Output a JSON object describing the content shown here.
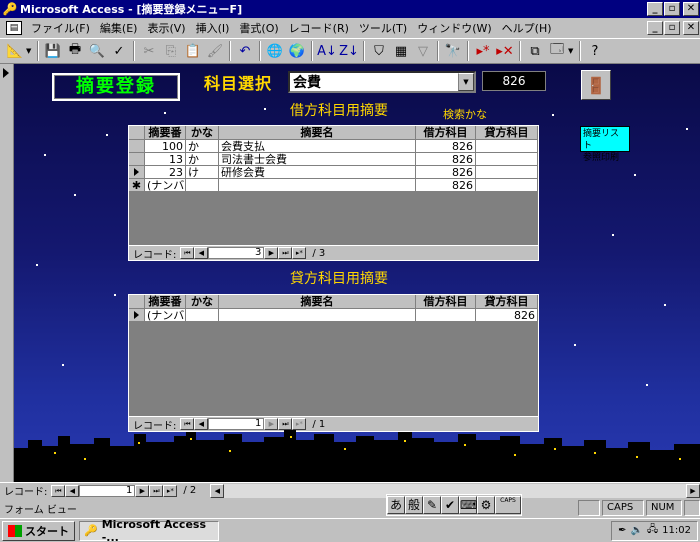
{
  "window": {
    "title": "Microsoft Access - [摘要登録メニューF]"
  },
  "menu": [
    "ファイル(F)",
    "編集(E)",
    "表示(V)",
    "挿入(I)",
    "書式(O)",
    "レコード(R)",
    "ツール(T)",
    "ウィンドウ(W)",
    "ヘルプ(H)"
  ],
  "form": {
    "title": "摘要登録",
    "subject_label": "科目選択",
    "subject_value": "会費",
    "subject_code": "826",
    "print_button": "摘要リスト\n参照印刷",
    "kana_search_label": "検索かな"
  },
  "debit": {
    "label": "借方科目用摘要",
    "headers": [
      "摘要番",
      "かな",
      "摘要名",
      "借方科目",
      "貸方科目"
    ],
    "rows": [
      {
        "no": "100",
        "kana": "か",
        "name": "会費支払",
        "debit": "826",
        "credit": ""
      },
      {
        "no": "13",
        "kana": "か",
        "name": "司法書士会費",
        "debit": "826",
        "credit": ""
      },
      {
        "no": "23",
        "kana": "け",
        "name": "研修会費",
        "debit": "826",
        "credit": ""
      }
    ],
    "new_row": {
      "no": "(ナンバー)",
      "debit": "826"
    },
    "nav": {
      "label": "レコード:",
      "current": "3",
      "total": "/ 3"
    }
  },
  "credit": {
    "label": "貸方科目用摘要",
    "headers": [
      "摘要番",
      "かな",
      "摘要名",
      "借方科目",
      "貸方科目"
    ],
    "new_row": {
      "no": "(ナンバー)",
      "credit": "826"
    },
    "nav": {
      "label": "レコード:",
      "current": "1",
      "total": "/ 1"
    }
  },
  "main_nav": {
    "label": "レコード:",
    "current": "1",
    "total": "/ 2"
  },
  "status": {
    "text": "フォーム ビュー",
    "caps": "CAPS",
    "num": "NUM",
    "ime_mode": "あ",
    "ime_conv": "般"
  },
  "taskbar": {
    "start": "スタート",
    "task": "Microsoft Access -...",
    "clock": "11:02"
  },
  "colors": {
    "title_bar": "#000080",
    "form_title_text": "#00ff00",
    "label_text": "#ffd700",
    "print_button_bg": "#00ffff"
  }
}
